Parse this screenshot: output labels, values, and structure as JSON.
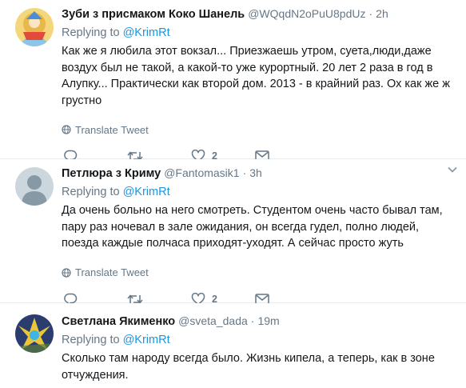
{
  "replying_label": "Replying to",
  "translate_label": "Translate Tweet",
  "tweets": [
    {
      "name": "Зуби з присмаком Коко Шанель",
      "handle": "@WQqdN2oPuU8pdUz",
      "time": "2h",
      "reply_to": "@KrimRt",
      "text": "Как же я любила этот вокзал... Приезжаешь утром, суета,люди,даже воздух был не такой, а какой-то уже курортный. 20 лет 2 раза в год в Алупку... Практически как второй дом. 2013 - в крайний раз. Ох как же ж грустно",
      "likes": "2"
    },
    {
      "name": "Петлюра з Криму",
      "handle": "@Fantomasik1",
      "time": "3h",
      "reply_to": "@KrimRt",
      "text": "Да очень больно на него смотреть. Студентом очень часто бывал там, пару раз ночевал в зале ожидания, он всегда гудел, полно людей, поезда каждые полчаса приходят-уходят. А сейчас просто жуть",
      "likes": "2"
    },
    {
      "name": "Светлана Якименко",
      "handle": "@sveta_dada",
      "time": "19m",
      "reply_to": "@KrimRt",
      "text": "Сколько там народу всегда было. Жизнь кипела, а теперь, как в зоне отчуждения."
    }
  ],
  "colors": {
    "accent": "#1b95e0",
    "muted": "#657786",
    "divider": "#e6ecf0"
  }
}
